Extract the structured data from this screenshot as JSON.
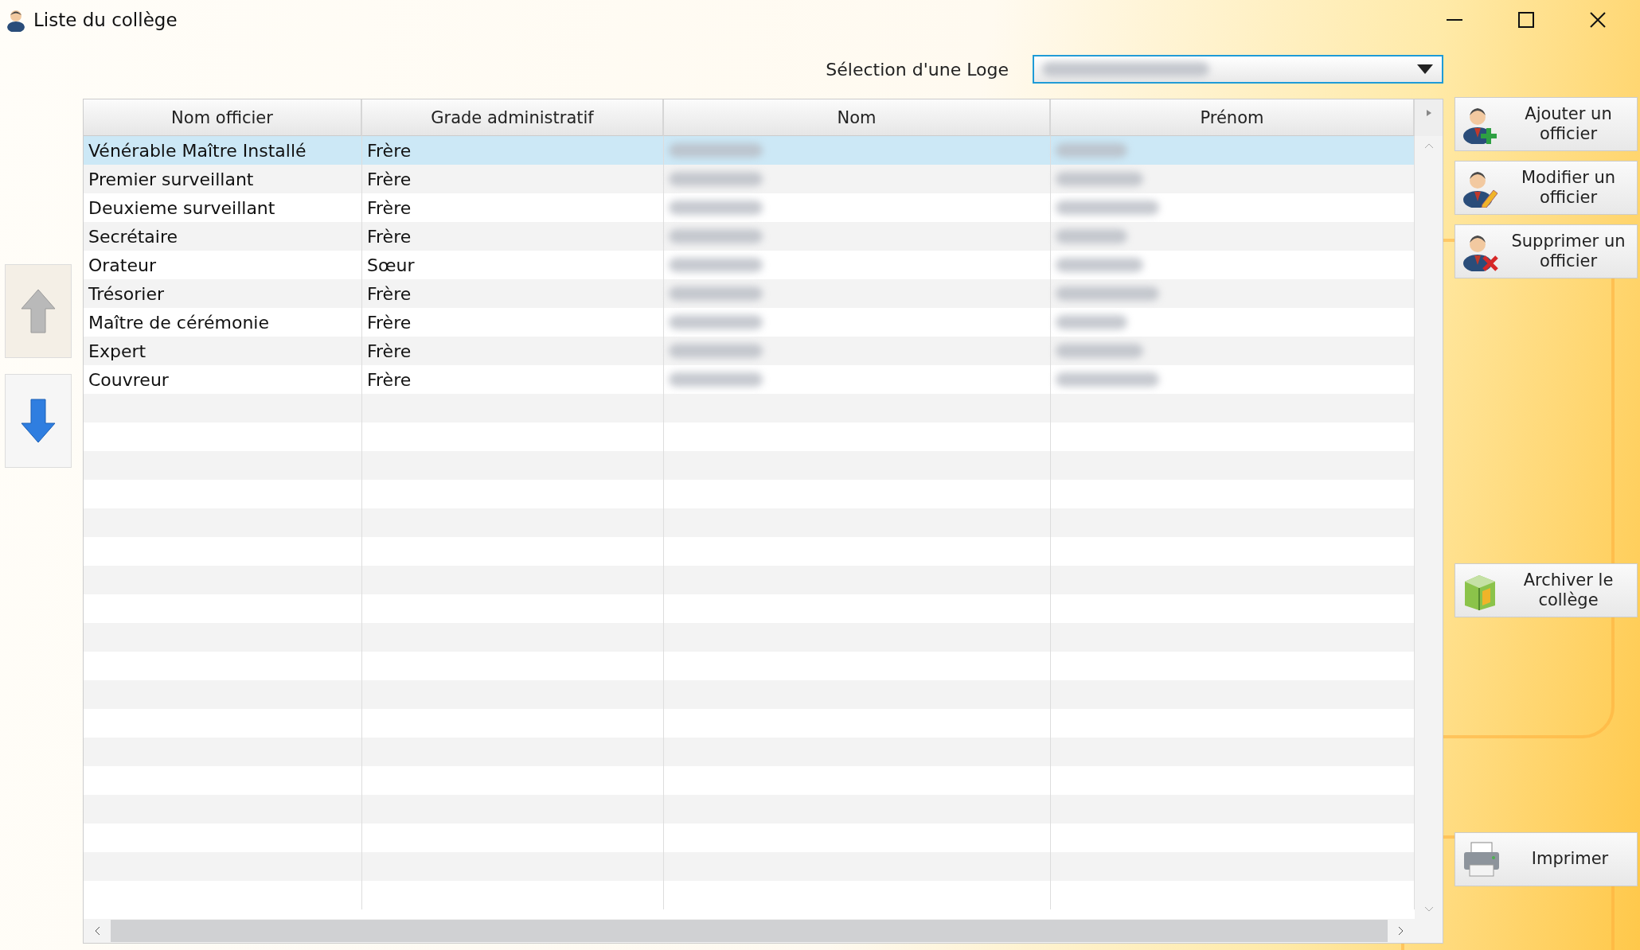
{
  "window": {
    "title": "Liste du collège"
  },
  "loge": {
    "label": "Sélection d'une Loge",
    "value_redacted": true
  },
  "table": {
    "columns": [
      "Nom officier",
      "Grade administratif",
      "Nom",
      "Prénom"
    ],
    "rows": [
      {
        "officer": "Vénérable Maître Installé",
        "grade": "Frère",
        "nom_redacted": true,
        "prenom_redacted": true,
        "selected": true
      },
      {
        "officer": "Premier surveillant",
        "grade": "Frère",
        "nom_redacted": true,
        "prenom_redacted": true,
        "selected": false
      },
      {
        "officer": "Deuxieme surveillant",
        "grade": "Frère",
        "nom_redacted": true,
        "prenom_redacted": true,
        "selected": false
      },
      {
        "officer": "Secrétaire",
        "grade": "Frère",
        "nom_redacted": true,
        "prenom_redacted": true,
        "selected": false
      },
      {
        "officer": "Orateur",
        "grade": "Sœur",
        "nom_redacted": true,
        "prenom_redacted": true,
        "selected": false
      },
      {
        "officer": "Trésorier",
        "grade": "Frère",
        "nom_redacted": true,
        "prenom_redacted": true,
        "selected": false
      },
      {
        "officer": "Maître de cérémonie",
        "grade": "Frère",
        "nom_redacted": true,
        "prenom_redacted": true,
        "selected": false
      },
      {
        "officer": "Expert",
        "grade": "Frère",
        "nom_redacted": true,
        "prenom_redacted": true,
        "selected": false
      },
      {
        "officer": "Couvreur",
        "grade": "Frère",
        "nom_redacted": true,
        "prenom_redacted": true,
        "selected": false
      }
    ]
  },
  "move_buttons": [
    {
      "kind": "up",
      "disabled": true
    },
    {
      "kind": "down",
      "disabled": false
    }
  ],
  "actions": [
    {
      "kind": "add",
      "label": "Ajouter un officier"
    },
    {
      "kind": "edit",
      "label": "Modifier un officier"
    },
    {
      "kind": "delete",
      "label": "Supprimer un officier"
    },
    {
      "kind": "archive",
      "label": "Archiver le collège"
    },
    {
      "kind": "print",
      "label": "Imprimer"
    }
  ]
}
